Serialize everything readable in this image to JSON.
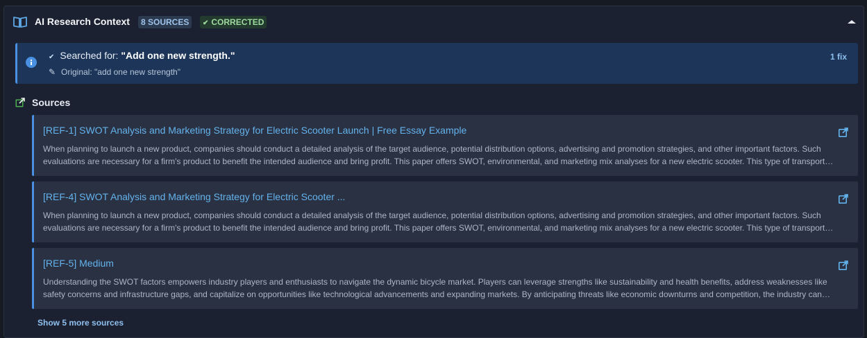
{
  "header": {
    "title": "AI Research Context",
    "sources_badge": "8 SOURCES",
    "corrected_badge": "CORRECTED"
  },
  "info": {
    "searched_label": "Searched for:",
    "searched_query": "\"Add one new strength.\"",
    "original_text": "Original: \"add one new strength\"",
    "fix_count": "1 fix"
  },
  "sources": {
    "heading": "Sources",
    "items": [
      {
        "title": "[REF-1] SWOT Analysis and Marketing Strategy for Electric Scooter Launch | Free Essay Example",
        "snippet": "When planning to launch a new product, companies should conduct a detailed analysis of the target audience, potential distribution options, advertising and promotion strategies, and other important factors. Such evaluations are necessary for a firm's product to benefit the intended audience and bring profit. This paper offers SWOT, environmental, and marketing mix analyses for a new electric scooter. This type of transport…"
      },
      {
        "title": "[REF-4] SWOT Analysis and Marketing Strategy for Electric Scooter ...",
        "snippet": "When planning to launch a new product, companies should conduct a detailed analysis of the target audience, potential distribution options, advertising and promotion strategies, and other important factors. Such evaluations are necessary for a firm's product to benefit the intended audience and bring profit. This paper offers SWOT, environmental, and marketing mix analyses for a new electric scooter. This type of transport…"
      },
      {
        "title": "[REF-5] Medium",
        "snippet": "Understanding the SWOT factors empowers industry players and enthusiasts to navigate the dynamic bicycle market. Players can leverage strengths like sustainability and health benefits, address weaknesses like safety concerns and infrastructure gaps, and capitalize on opportunities like technological advancements and expanding markets. By anticipating threats like economic downturns and competition, the industry can ens…"
      }
    ],
    "show_more": "Show 5 more sources"
  },
  "colors": {
    "accent": "#4a90e2",
    "link": "#63b3ed",
    "success": "#9edb9e"
  },
  "icons": [
    "book-open-icon",
    "check-icon",
    "chevron-up-icon",
    "info-icon",
    "pencil-icon",
    "external-link-icon"
  ]
}
